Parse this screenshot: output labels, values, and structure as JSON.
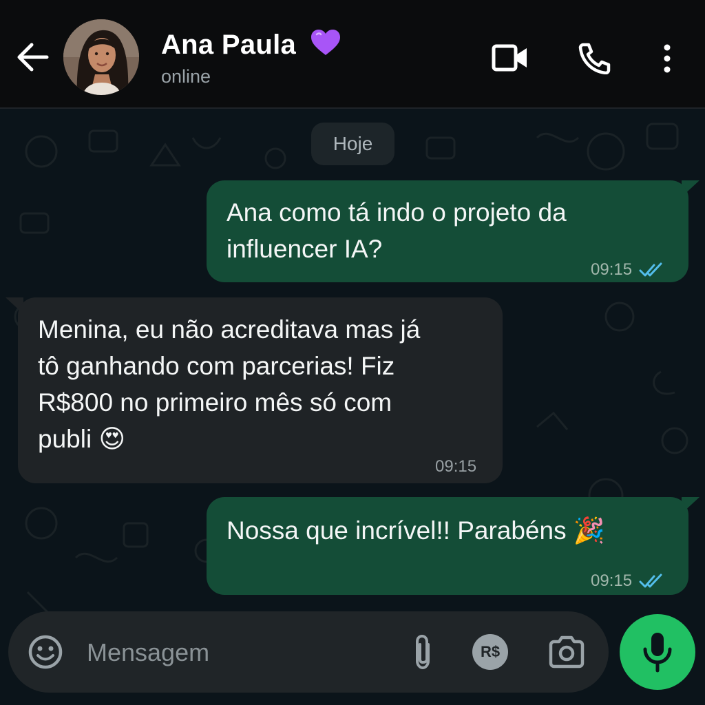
{
  "header": {
    "contact_name": "Ana Paula",
    "status": "online"
  },
  "chat": {
    "day_label": "Hoje",
    "messages": [
      {
        "direction": "outgoing",
        "text": "Ana como tá indo o projeto da\ninfluencer IA?",
        "time": "09:15",
        "read": true
      },
      {
        "direction": "incoming",
        "text": "Menina, eu não acreditava mas já\ntô ganhando com parcerias! Fiz\nR$800 no primeiro mês só com\npubli 😍",
        "time": "09:15"
      },
      {
        "direction": "outgoing",
        "text": "Nossa que incrível!! Parabéns 🎉",
        "time": "09:15",
        "read": true
      }
    ]
  },
  "composer": {
    "placeholder": "Mensagem",
    "pix_label": "R$"
  },
  "icons": {
    "back": "arrow-left-icon",
    "heart": "purple-heart-icon",
    "video": "video-camera-icon",
    "call": "phone-icon",
    "menu": "more-vertical-icon",
    "emoji": "emoji-icon",
    "attach": "paperclip-icon",
    "pix": "currency-icon",
    "camera": "camera-icon",
    "mic": "microphone-icon"
  },
  "colors": {
    "outgoing_bubble": "#144d37",
    "incoming_bubble": "#1f2326",
    "read_ticks": "#53bdeb",
    "mic_button": "#21c063",
    "heart": "#a855f7"
  }
}
